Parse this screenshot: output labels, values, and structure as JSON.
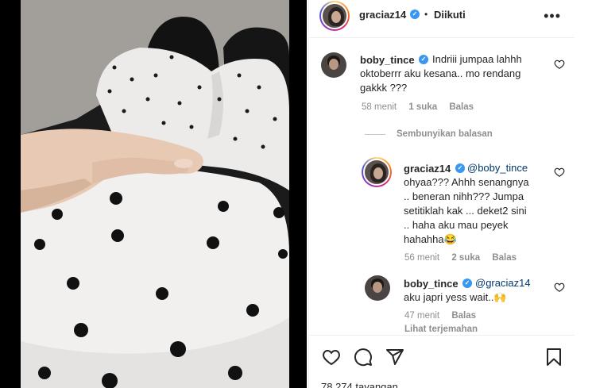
{
  "post": {
    "author": "graciaz14",
    "separator": "•",
    "follow_state": "Diikuti",
    "more_label": "•••"
  },
  "comments": [
    {
      "username": "boby_tince",
      "mention": "",
      "text_lines": [
        "Indriii jumpaa lahhh",
        "oktoberrr aku kesana.. mo rendang",
        "gakkk ???"
      ],
      "time": "58 menit",
      "likes": "1 suka",
      "reply": "Balas"
    }
  ],
  "hide_replies": "Sembunyikan balasan",
  "replies": [
    {
      "username": "graciaz14",
      "mention": "@boby_tince",
      "text_lines": [
        "ohyaa??? Ahhh senangnya",
        ".. beneran nihh??? Jumpa",
        "setitiklah kak ... deket2 sini",
        ".. haha aku mau peyek",
        "hahahha😂"
      ],
      "time": "56 menit",
      "likes": "2 suka",
      "reply": "Balas"
    },
    {
      "username": "boby_tince",
      "mention": "@graciaz14",
      "text_lines": [
        "aku japri yess wait..🙌"
      ],
      "time": "47 menit",
      "reply": "Balas",
      "translate": "Lihat terjemahan"
    }
  ],
  "footer": {
    "views": "78.274 tayangan"
  },
  "icons": {
    "like": "heart-icon",
    "comment": "comment-icon",
    "share": "share-icon",
    "save": "bookmark-icon",
    "verified": "verified-badge-icon"
  },
  "colors": {
    "verified": "#3897f0",
    "muted": "#8e8e8e",
    "mention": "#00376b"
  }
}
